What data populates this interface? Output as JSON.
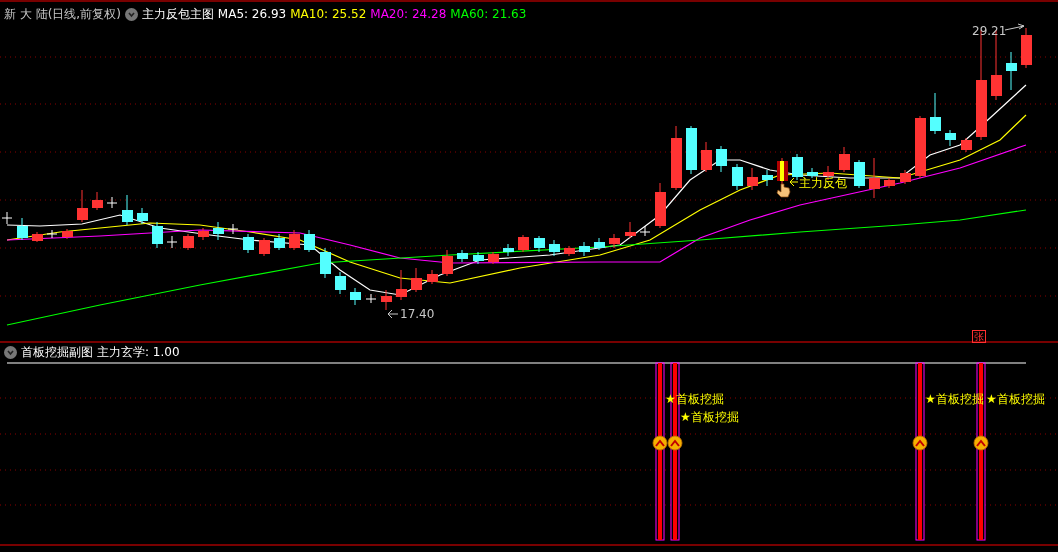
{
  "main_panel": {
    "title": "新 大 陆(日线,前复权)",
    "indicator_name": "主力反包主图",
    "moving_averages": [
      {
        "label": "MA5: 26.93",
        "color": "#ffffff"
      },
      {
        "label": "MA10: 25.52",
        "color": "#ffff00"
      },
      {
        "label": "MA20: 24.28",
        "color": "#ff00ff"
      },
      {
        "label": "MA60: 21.63",
        "color": "#00ff00"
      }
    ],
    "high_label": "29.21",
    "low_label": "17.40",
    "signal_label": "主力反包",
    "badge": "张"
  },
  "sub_panel": {
    "title": "首板挖掘副图",
    "value_label": "主力玄学: 1.00",
    "signals": [
      {
        "label": "★首板挖掘"
      },
      {
        "label": "★首板挖掘"
      },
      {
        "label": "★首板挖掘"
      },
      {
        "label": "★首板挖掘"
      }
    ]
  }
}
